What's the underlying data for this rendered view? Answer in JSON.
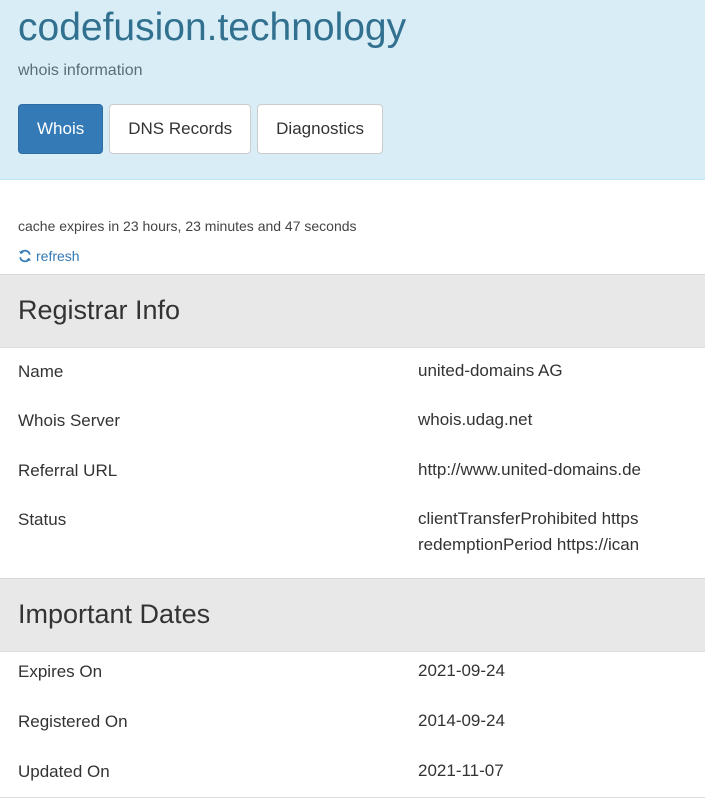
{
  "header": {
    "domain": "codefusion.technology",
    "subtitle": "whois information",
    "tabs": [
      {
        "label": "Whois",
        "active": true
      },
      {
        "label": "DNS Records",
        "active": false
      },
      {
        "label": "Diagnostics",
        "active": false
      }
    ]
  },
  "cache": {
    "text": "cache expires in 23 hours, 23 minutes and 47 seconds",
    "refresh_label": "refresh"
  },
  "registrar": {
    "heading": "Registrar Info",
    "rows": [
      {
        "label": "Name",
        "value": "united-domains AG"
      },
      {
        "label": "Whois Server",
        "value": "whois.udag.net"
      },
      {
        "label": "Referral URL",
        "value": "http://www.united-domains.de"
      },
      {
        "label": "Status",
        "value": "clientTransferProhibited https",
        "value2": "redemptionPeriod https://ican"
      }
    ]
  },
  "dates": {
    "heading": "Important Dates",
    "rows": [
      {
        "label": "Expires On",
        "value": "2021-09-24"
      },
      {
        "label": "Registered On",
        "value": "2014-09-24"
      },
      {
        "label": "Updated On",
        "value": "2021-11-07"
      }
    ]
  },
  "colors": {
    "header_bg": "#d9edf7",
    "title": "#31708f",
    "active_tab": "#337ab7",
    "link": "#337ab7",
    "section_bg": "#e8e8e8"
  },
  "icons": {
    "refresh": "refresh-icon"
  }
}
